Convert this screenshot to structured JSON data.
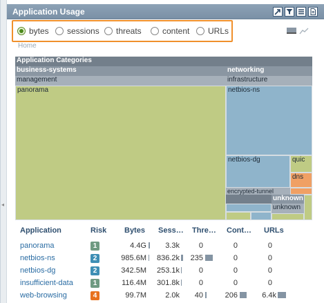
{
  "widget": {
    "title": "Application Usage",
    "toolbar_icons": [
      "jump-to-icon",
      "filter-icon",
      "list-icon",
      "document-icon"
    ]
  },
  "metric_selector": {
    "options": [
      {
        "label": "bytes",
        "selected": true
      },
      {
        "label": "sessions",
        "selected": false
      },
      {
        "label": "threats",
        "selected": false
      },
      {
        "label": "content",
        "selected": false
      },
      {
        "label": "URLs",
        "selected": false
      }
    ]
  },
  "chart_view_icons": [
    "bar-chart-icon",
    "line-chart-icon"
  ],
  "breadcrumb": {
    "home_label": "Home"
  },
  "treemap": {
    "root_label": "Application Categories",
    "categories": [
      {
        "label": "business-systems",
        "subcategories": [
          {
            "label": "management",
            "apps": [
              "panorama"
            ]
          }
        ]
      },
      {
        "label": "networking",
        "subcategories": [
          {
            "label": "infrastructure",
            "apps": [
              "netbios-ns",
              "netbios-dg",
              "quic",
              "dns"
            ]
          },
          {
            "label": "encrypted-tunnel"
          },
          {
            "label": "unknown",
            "apps": [
              "unknown"
            ]
          }
        ]
      }
    ],
    "colors": {
      "green": "#bfcb84",
      "blue": "#8fb4cb",
      "orange": "#f0a064",
      "header": "#737f8b"
    }
  },
  "table": {
    "columns": [
      "Application",
      "Risk",
      "Bytes",
      "Sess…",
      "Thre…",
      "Cont…",
      "URLs"
    ],
    "rows": [
      {
        "app": "panorama",
        "risk": "1",
        "risk_color": "#6f9a82",
        "bytes": "4.4G",
        "sessions": "3.3k",
        "threats": "0",
        "content": "0",
        "urls": "0"
      },
      {
        "app": "netbios-ns",
        "risk": "2",
        "risk_color": "#3e8fb5",
        "bytes": "985.6M",
        "sessions": "836.2k",
        "threats": "235",
        "content": "0",
        "urls": "0"
      },
      {
        "app": "netbios-dg",
        "risk": "2",
        "risk_color": "#3e8fb5",
        "bytes": "342.5M",
        "sessions": "253.1k",
        "threats": "0",
        "content": "0",
        "urls": "0"
      },
      {
        "app": "insufficient-data",
        "risk": "1",
        "risk_color": "#6f9a82",
        "bytes": "116.4M",
        "sessions": "301.8k",
        "threats": "0",
        "content": "0",
        "urls": "0"
      },
      {
        "app": "web-browsing",
        "risk": "4",
        "risk_color": "#e8711c",
        "bytes": "99.7M",
        "sessions": "2.0k",
        "threats": "40",
        "content": "206",
        "urls": "6.4k"
      }
    ]
  }
}
